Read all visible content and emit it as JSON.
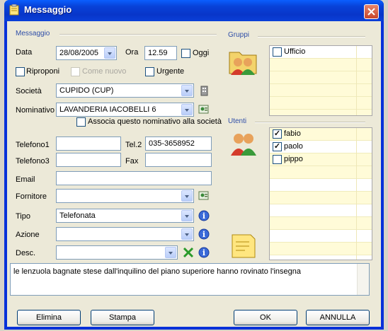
{
  "window": {
    "title": "Messaggio"
  },
  "sections": {
    "messaggio": "Messaggio",
    "gruppi": "Gruppi",
    "utenti": "Utenti"
  },
  "form": {
    "data_label": "Data",
    "data_value": "28/08/2005",
    "ora_label": "Ora",
    "ora_value": "12.59",
    "oggi_label": "Oggi",
    "oggi_checked": false,
    "riproponi_label": "Riproponi",
    "riproponi_checked": false,
    "come_nuovo_label": "Come nuovo",
    "come_nuovo_enabled": false,
    "urgente_label": "Urgente",
    "urgente_checked": false,
    "societa_label": "Società",
    "societa_value": "CUPIDO (CUP)",
    "nominativo_label": "Nominativo",
    "nominativo_value": "LAVANDERIA IACOBELLI  6",
    "associa_label": "Associa questo nominativo alla società",
    "associa_checked": false,
    "telefono1_label": "Telefono1",
    "telefono1_value": "",
    "tel2_label": "Tel.2",
    "tel2_value": "035-3658952",
    "telefono3_label": "Telefono3",
    "telefono3_value": "",
    "fax_label": "Fax",
    "fax_value": "",
    "email_label": "Email",
    "email_value": "",
    "fornitore_label": "Fornitore",
    "fornitore_value": "",
    "tipo_label": "Tipo",
    "tipo_value": "Telefonata",
    "azione_label": "Azione",
    "azione_value": "",
    "desc_label": "Desc.",
    "desc_value": ""
  },
  "gruppi": [
    {
      "name": "Ufficio",
      "checked": false
    }
  ],
  "utenti": [
    {
      "name": "fabio",
      "checked": true
    },
    {
      "name": "paolo",
      "checked": true
    },
    {
      "name": "pippo",
      "checked": false
    }
  ],
  "notes": "le lenzuola bagnate stese dall'inquilino del piano superiore hanno rovinato l'insegna",
  "buttons": {
    "elimina": "Elimina",
    "stampa": "Stampa",
    "ok": "OK",
    "annulla": "ANNULLA"
  },
  "colors": {
    "titlebar": "#0842d8",
    "section_text": "#2f4ea8",
    "grid_row": "#fffbd8",
    "close": "#c9452a"
  }
}
